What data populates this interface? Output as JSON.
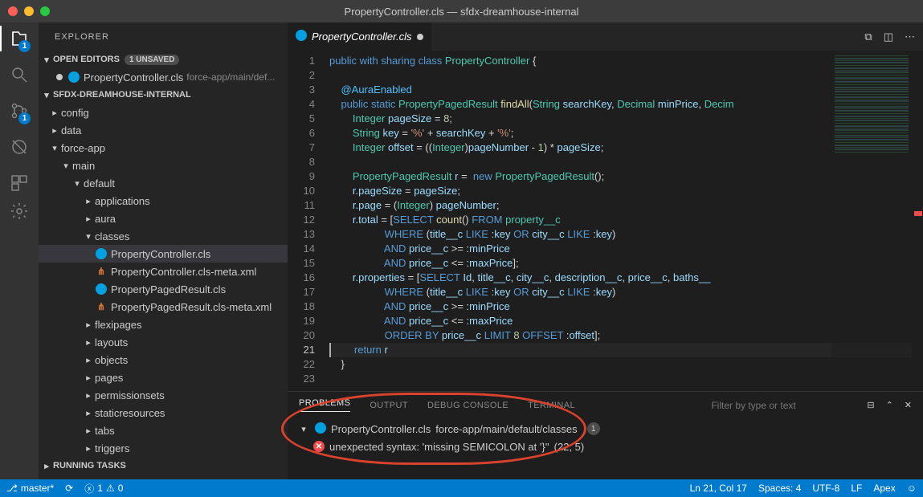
{
  "window": {
    "title": "PropertyController.cls — sfdx-dreamhouse-internal"
  },
  "explorer": {
    "title": "EXPLORER",
    "openEditors": {
      "label": "OPEN EDITORS",
      "unsaved": "1 UNSAVED"
    },
    "editorItem": {
      "name": "PropertyController.cls",
      "path": "force-app/main/def..."
    },
    "workspace": "SFDX-DREAMHOUSE-INTERNAL",
    "folders": {
      "config": "config",
      "data": "data",
      "forceapp": "force-app",
      "main": "main",
      "default": "default",
      "applications": "applications",
      "aura": "aura",
      "classes": "classes",
      "f1": "PropertyController.cls",
      "f2": "PropertyController.cls-meta.xml",
      "f3": "PropertyPagedResult.cls",
      "f4": "PropertyPagedResult.cls-meta.xml",
      "flexipages": "flexipages",
      "layouts": "layouts",
      "objects": "objects",
      "pages": "pages",
      "permissionsets": "permissionsets",
      "staticresources": "staticresources",
      "tabs": "tabs",
      "triggers": "triggers"
    },
    "running": "RUNNING TASKS"
  },
  "tab": {
    "name": "PropertyController.cls"
  },
  "panel": {
    "tabs": {
      "problems": "PROBLEMS",
      "output": "OUTPUT",
      "debug": "DEBUG CONSOLE",
      "terminal": "TERMINAL"
    },
    "filterPlaceholder": "Filter by type or text",
    "file": "PropertyController.cls",
    "filePath": "force-app/main/default/classes",
    "count": "1",
    "msg": "unexpected syntax: 'missing SEMICOLON at '}''",
    "loc": "(22, 5)"
  },
  "status": {
    "branch": "master*",
    "sync": "",
    "err": "1",
    "warn": "0",
    "ln": "Ln 21, Col 17",
    "spaces": "Spaces: 4",
    "enc": "UTF-8",
    "eol": "LF",
    "lang": "Apex"
  },
  "gutter": [
    "1",
    "2",
    "3",
    "4",
    "5",
    "6",
    "7",
    "8",
    "9",
    "10",
    "11",
    "12",
    "13",
    "14",
    "15",
    "16",
    "17",
    "18",
    "19",
    "20",
    "21",
    "22",
    "23"
  ]
}
